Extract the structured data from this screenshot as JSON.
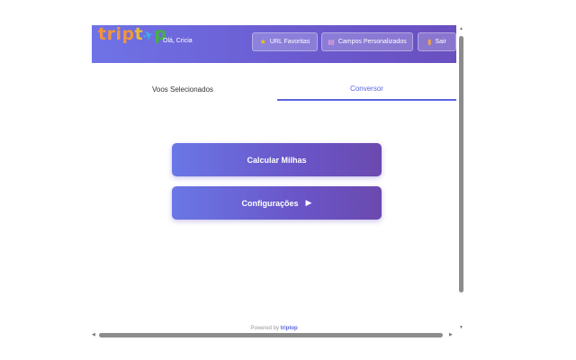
{
  "header": {
    "logo": {
      "part1": "trip",
      "part2": "t",
      "plane": "✈",
      "part3": "p"
    },
    "greeting": "Olá, Cricia",
    "buttons": {
      "url_favoritas": {
        "icon": "star-icon",
        "label": "URL Favoritas"
      },
      "campos_personalizados": {
        "icon": "clipboard-icon",
        "label": "Campos Personalizados"
      },
      "sair": {
        "icon": "door-icon",
        "label": "Sair"
      }
    }
  },
  "tabs": [
    {
      "label": "Voos Selecionados",
      "active": false
    },
    {
      "label": "Conversor",
      "active": true
    }
  ],
  "actions": {
    "calcular": {
      "label": "Calcular Milhas"
    },
    "configuracoes": {
      "label": "Configurações",
      "icon": "play-icon"
    }
  },
  "footer": {
    "prefix": "Powered by",
    "brand": "triptop"
  },
  "colors": {
    "accent": "#5a66e0",
    "header_start": "#6f73e6",
    "header_end": "#6a4fc0"
  }
}
